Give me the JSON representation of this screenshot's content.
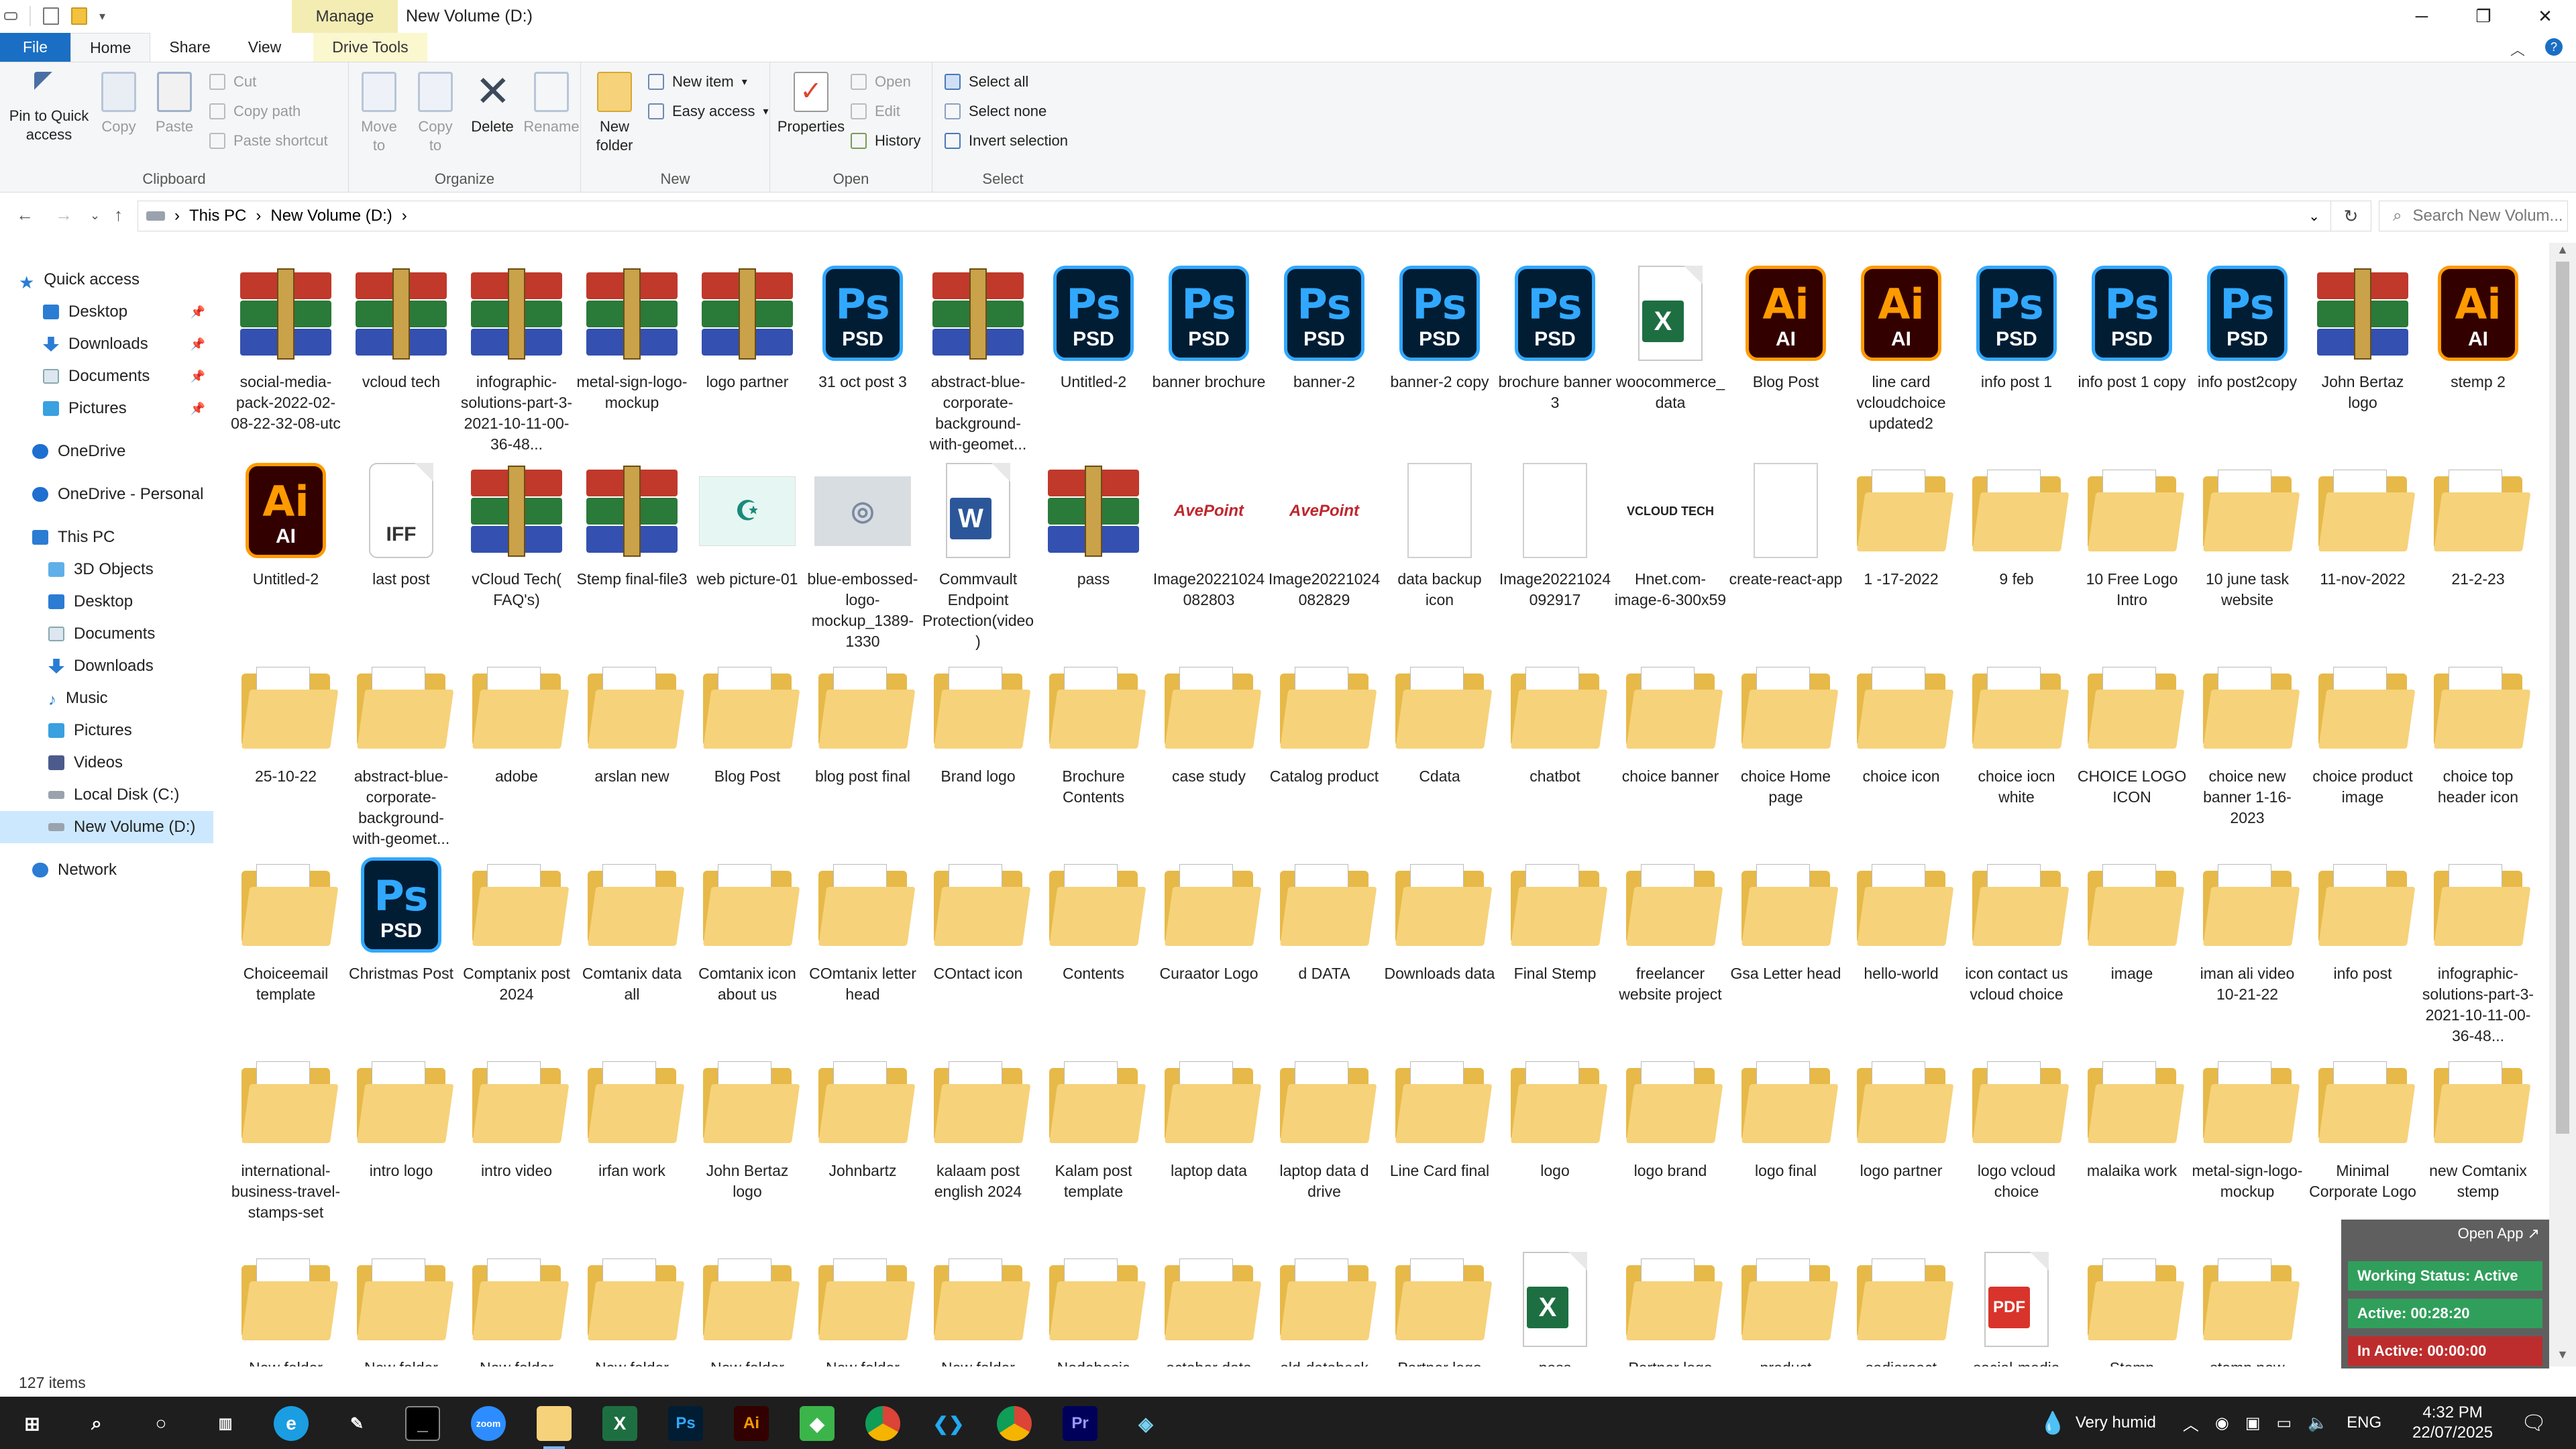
{
  "window": {
    "title": "New Volume (D:)",
    "manage_tab": "Manage",
    "controls": {
      "minimize": "─",
      "restore": "❐",
      "close": "✕"
    }
  },
  "ribbon_tabs": [
    "File",
    "Home",
    "Share",
    "View",
    "Drive Tools"
  ],
  "ribbon": {
    "clipboard": {
      "label": "Clipboard",
      "pin": "Pin to Quick access",
      "copy": "Copy",
      "paste": "Paste",
      "cut": "Cut",
      "copy_path": "Copy path",
      "paste_shortcut": "Paste shortcut"
    },
    "organize": {
      "label": "Organize",
      "move_to": "Move to",
      "copy_to": "Copy to",
      "delete": "Delete",
      "rename": "Rename"
    },
    "new": {
      "label": "New",
      "new_folder": "New folder",
      "new_item": "New item",
      "easy_access": "Easy access"
    },
    "open": {
      "label": "Open",
      "properties": "Properties",
      "open": "Open",
      "edit": "Edit",
      "history": "History"
    },
    "select": {
      "label": "Select",
      "select_all": "Select all",
      "select_none": "Select none",
      "invert": "Invert selection"
    }
  },
  "address": {
    "crumbs": [
      "This PC",
      "New Volume (D:)"
    ],
    "search_placeholder": "Search New Volum..."
  },
  "nav_pane": {
    "quick_access": "Quick access",
    "qa_items": [
      "Desktop",
      "Downloads",
      "Documents",
      "Pictures"
    ],
    "onedrive": "OneDrive",
    "onedrive_personal": "OneDrive - Personal",
    "this_pc": "This PC",
    "pc_items": [
      "3D Objects",
      "Desktop",
      "Documents",
      "Downloads",
      "Music",
      "Pictures",
      "Videos",
      "Local Disk (C:)",
      "New Volume (D:)"
    ],
    "network": "Network"
  },
  "rows": [
    [
      {
        "name": "social-media-pack-2022-02-08-22-32-08-utc",
        "icon": "rar"
      },
      {
        "name": "vcloud tech",
        "icon": "rar"
      },
      {
        "name": "infographic-solutions-part-3-2021-10-11-00-36-48...",
        "icon": "rar"
      },
      {
        "name": "metal-sign-logo-mockup",
        "icon": "rar"
      },
      {
        "name": "logo partner",
        "icon": "rar"
      },
      {
        "name": "31 oct post 3",
        "icon": "psd"
      },
      {
        "name": "abstract-blue-corporate-background-with-geomet...",
        "icon": "rar"
      },
      {
        "name": "Untitled-2",
        "icon": "psd"
      },
      {
        "name": "banner brochure",
        "icon": "psd"
      },
      {
        "name": "banner-2",
        "icon": "psd"
      },
      {
        "name": "banner-2 copy",
        "icon": "psd"
      },
      {
        "name": "brochure banner 3",
        "icon": "psd"
      },
      {
        "name": "woocommerce_data",
        "icon": "xlsx"
      },
      {
        "name": "Blog Post",
        "icon": "ai"
      },
      {
        "name": "line card vcloudchoice updated2",
        "icon": "ai"
      },
      {
        "name": "info post 1",
        "icon": "psd"
      },
      {
        "name": "info post 1 copy",
        "icon": "psd"
      },
      {
        "name": "info post2copy",
        "icon": "psd"
      },
      {
        "name": "John Bertaz logo",
        "icon": "rar"
      },
      {
        "name": "stemp 2",
        "icon": "ai"
      }
    ],
    [
      {
        "name": "Untitled-2",
        "icon": "ai"
      },
      {
        "name": "last post",
        "icon": "iff"
      },
      {
        "name": "vCloud Tech( FAQ's)",
        "icon": "rar"
      },
      {
        "name": "Stemp final-file3",
        "icon": "rar"
      },
      {
        "name": "web picture-01",
        "icon": "thumb-teal"
      },
      {
        "name": "blue-embossed-logo-mockup_1389-1330",
        "icon": "thumb-grey"
      },
      {
        "name": "Commvault Endpoint Protection(video)",
        "icon": "docx"
      },
      {
        "name": "pass",
        "icon": "rar"
      },
      {
        "name": "Image20221024082803",
        "icon": "thumb-avepoint"
      },
      {
        "name": "Image20221024082829",
        "icon": "thumb-avepoint"
      },
      {
        "name": "data backup icon",
        "icon": "blank"
      },
      {
        "name": "Image20221024092917",
        "icon": "blank"
      },
      {
        "name": "Hnet.com-image-6-300x59",
        "icon": "thumb-vcloud"
      },
      {
        "name": "create-react-app",
        "icon": "blank"
      },
      {
        "name": "1 -17-2022",
        "icon": "folder"
      },
      {
        "name": "9 feb",
        "icon": "folder"
      },
      {
        "name": "10 Free Logo Intro",
        "icon": "folder"
      },
      {
        "name": "10 june task website",
        "icon": "folder"
      },
      {
        "name": "11-nov-2022",
        "icon": "folder"
      },
      {
        "name": "21-2-23",
        "icon": "folder"
      }
    ],
    [
      {
        "name": "25-10-22",
        "icon": "folder"
      },
      {
        "name": "abstract-blue-corporate-background-with-geomet...",
        "icon": "folder"
      },
      {
        "name": "adobe",
        "icon": "folder"
      },
      {
        "name": "arslan new",
        "icon": "folder"
      },
      {
        "name": "Blog Post",
        "icon": "folder"
      },
      {
        "name": "blog post final",
        "icon": "folder"
      },
      {
        "name": "Brand logo",
        "icon": "folder"
      },
      {
        "name": "Brochure Contents",
        "icon": "folder"
      },
      {
        "name": "case study",
        "icon": "folder"
      },
      {
        "name": "Catalog product",
        "icon": "folder"
      },
      {
        "name": "Cdata",
        "icon": "folder"
      },
      {
        "name": "chatbot",
        "icon": "folder"
      },
      {
        "name": "choice banner",
        "icon": "folder"
      },
      {
        "name": "choice Home page",
        "icon": "folder"
      },
      {
        "name": "choice icon",
        "icon": "folder"
      },
      {
        "name": "choice iocn white",
        "icon": "folder"
      },
      {
        "name": "CHOICE LOGO ICON",
        "icon": "folder"
      },
      {
        "name": "choice new banner 1-16-2023",
        "icon": "folder"
      },
      {
        "name": "choice product image",
        "icon": "folder"
      },
      {
        "name": "choice top header icon",
        "icon": "folder"
      }
    ],
    [
      {
        "name": "Choiceemail template",
        "icon": "folder"
      },
      {
        "name": "Christmas Post",
        "icon": "psd"
      },
      {
        "name": "Comptanix post 2024",
        "icon": "folder"
      },
      {
        "name": "Comtanix data all",
        "icon": "folder"
      },
      {
        "name": "Comtanix icon about us",
        "icon": "folder"
      },
      {
        "name": "COmtanix letter head",
        "icon": "folder"
      },
      {
        "name": "COntact icon",
        "icon": "folder"
      },
      {
        "name": "Contents",
        "icon": "folder"
      },
      {
        "name": "Curaator Logo",
        "icon": "folder"
      },
      {
        "name": "d  DATA",
        "icon": "folder"
      },
      {
        "name": "Downloads data",
        "icon": "folder"
      },
      {
        "name": "Final Stemp",
        "icon": "folder"
      },
      {
        "name": "freelancer website project",
        "icon": "folder"
      },
      {
        "name": "Gsa Letter head",
        "icon": "folder"
      },
      {
        "name": "hello-world",
        "icon": "folder"
      },
      {
        "name": "icon contact us vcloud choice",
        "icon": "folder"
      },
      {
        "name": "image",
        "icon": "folder"
      },
      {
        "name": "iman ali video 10-21-22",
        "icon": "folder"
      },
      {
        "name": "info post",
        "icon": "folder"
      },
      {
        "name": "infographic-solutions-part-3-2021-10-11-00-36-48...",
        "icon": "folder"
      }
    ],
    [
      {
        "name": "international-business-travel-stamps-set",
        "icon": "folder"
      },
      {
        "name": "intro logo",
        "icon": "folder"
      },
      {
        "name": "intro video",
        "icon": "folder"
      },
      {
        "name": "irfan work",
        "icon": "folder"
      },
      {
        "name": "John Bertaz logo",
        "icon": "folder"
      },
      {
        "name": "Johnbartz",
        "icon": "folder"
      },
      {
        "name": "kalaam post english 2024",
        "icon": "folder"
      },
      {
        "name": "Kalam post template",
        "icon": "folder"
      },
      {
        "name": "laptop data",
        "icon": "folder"
      },
      {
        "name": "laptop data d drive",
        "icon": "folder"
      },
      {
        "name": "Line Card final",
        "icon": "folder"
      },
      {
        "name": "logo",
        "icon": "folder"
      },
      {
        "name": "logo brand",
        "icon": "folder"
      },
      {
        "name": "logo final",
        "icon": "folder"
      },
      {
        "name": "logo partner",
        "icon": "folder"
      },
      {
        "name": "logo vcloud choice",
        "icon": "folder"
      },
      {
        "name": "malaika work",
        "icon": "folder"
      },
      {
        "name": "metal-sign-logo-mockup",
        "icon": "folder"
      },
      {
        "name": "Minimal Corporate Logo",
        "icon": "folder"
      },
      {
        "name": "new Comtanix stemp",
        "icon": "folder"
      }
    ],
    [
      {
        "name": "New folder",
        "icon": "folder"
      },
      {
        "name": "New folder",
        "icon": "folder"
      },
      {
        "name": "New folder",
        "icon": "folder"
      },
      {
        "name": "New folder",
        "icon": "folder"
      },
      {
        "name": "New folder",
        "icon": "folder"
      },
      {
        "name": "New folder",
        "icon": "folder"
      },
      {
        "name": "New folder",
        "icon": "folder"
      },
      {
        "name": "Nodebasic",
        "icon": "folder"
      },
      {
        "name": "october data",
        "icon": "folder"
      },
      {
        "name": "old-databack",
        "icon": "folder"
      },
      {
        "name": "Partner logo",
        "icon": "folder"
      },
      {
        "name": "pass",
        "icon": "xlsx"
      },
      {
        "name": "Pertner logo",
        "icon": "folder"
      },
      {
        "name": "product",
        "icon": "folder"
      },
      {
        "name": "sadiareact",
        "icon": "folder"
      },
      {
        "name": "social-media",
        "icon": "pdf"
      },
      {
        "name": "Stemp",
        "icon": "folder"
      },
      {
        "name": "stemp  new",
        "icon": "folder"
      },
      {
        "name": "",
        "icon": "none"
      },
      {
        "name": "",
        "icon": "none"
      }
    ]
  ],
  "status": {
    "items": "127 items"
  },
  "overlay": {
    "open_app": "Open App ↗",
    "working_status": "Working Status: Active",
    "active": "Active: 00:28:20",
    "inactive": "In Active: 00:00:00"
  },
  "taskbar": {
    "weather": "Very humid",
    "lang": "ENG",
    "time": "4:32 PM",
    "date": "22/07/2025",
    "apps": [
      "start",
      "search",
      "cortana",
      "task-view",
      "edge",
      "pen",
      "terminal",
      "zoom",
      "file-explorer",
      "excel",
      "photoshop",
      "illustrator",
      "app",
      "chrome",
      "vscode",
      "chrome-alt",
      "premiere",
      "app2"
    ]
  },
  "colors": {
    "file_tab": "#1a6fc4",
    "folder": "#f6d27a",
    "selection": "#cce8ff"
  }
}
